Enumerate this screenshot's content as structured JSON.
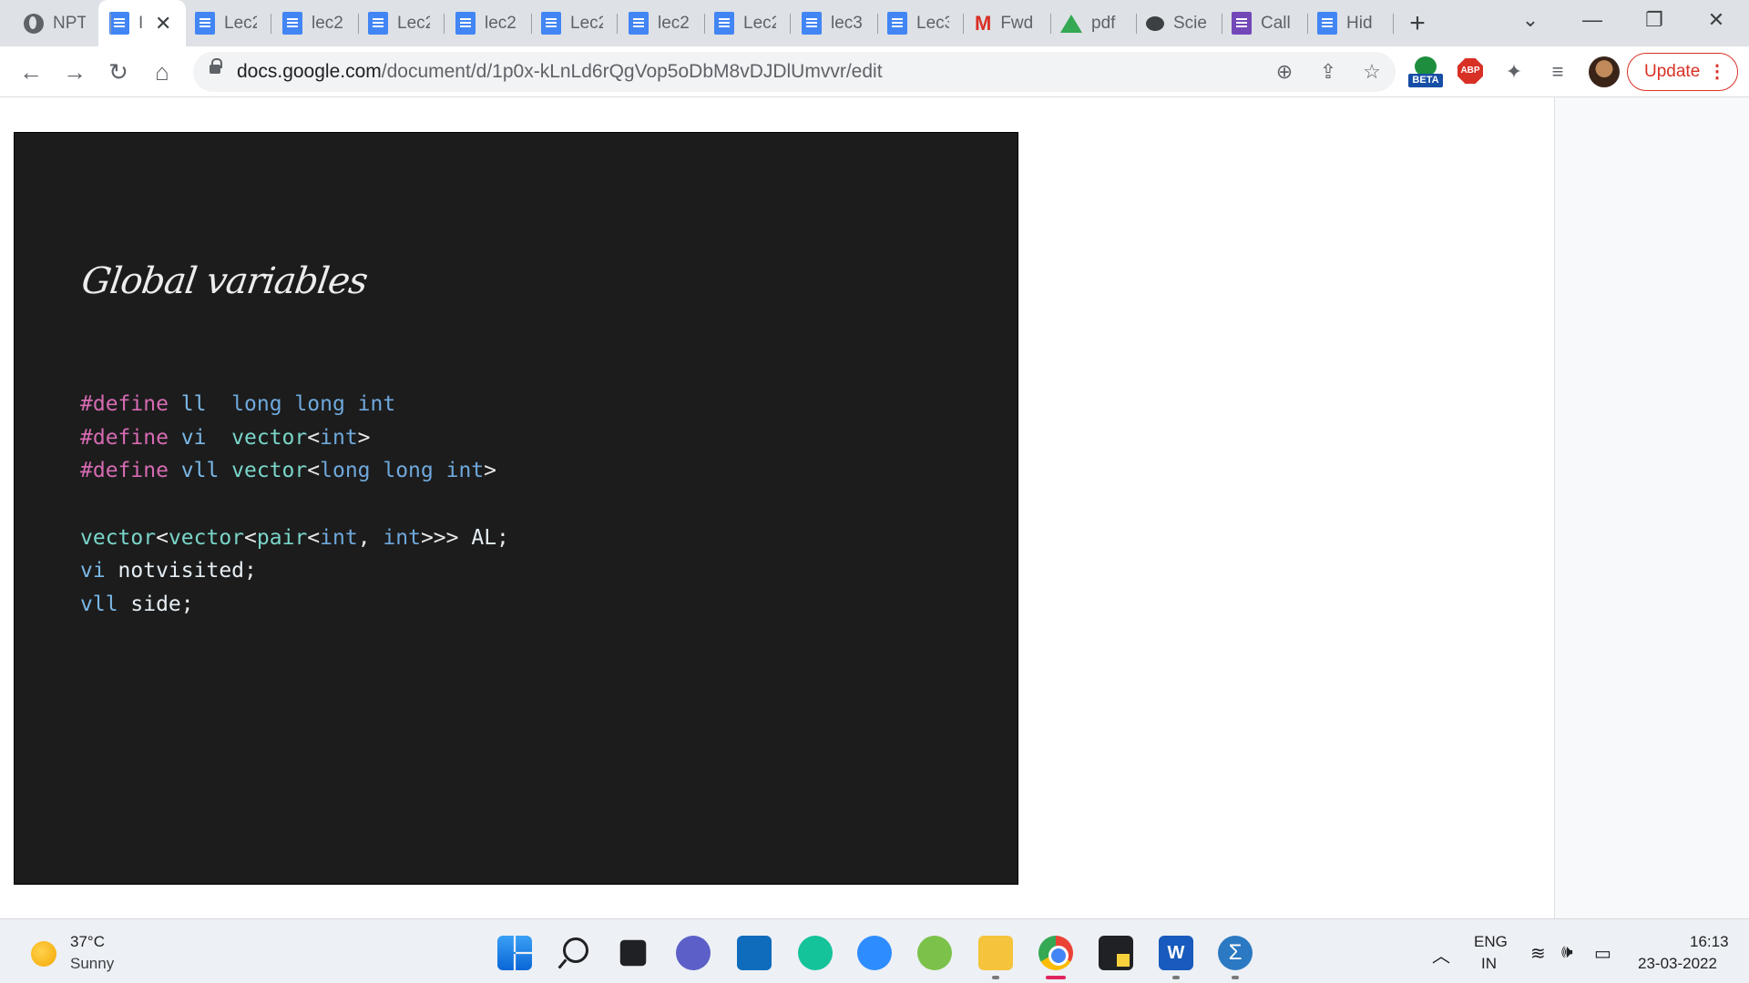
{
  "browser": {
    "tabs": [
      {
        "label": "NPT",
        "icon": "globe-icon"
      },
      {
        "label": "I",
        "icon": "docs-icon",
        "active": true
      },
      {
        "label": "Lec2",
        "icon": "docs-icon"
      },
      {
        "label": "lec2",
        "icon": "docs-icon"
      },
      {
        "label": "Lec2",
        "icon": "docs-icon"
      },
      {
        "label": "lec2",
        "icon": "docs-icon"
      },
      {
        "label": "Lec2",
        "icon": "docs-icon"
      },
      {
        "label": "lec2",
        "icon": "docs-icon"
      },
      {
        "label": "Lec2",
        "icon": "docs-icon"
      },
      {
        "label": "lec3",
        "icon": "docs-icon"
      },
      {
        "label": "Lec3",
        "icon": "docs-icon"
      },
      {
        "label": "Fwd",
        "icon": "gmail-icon"
      },
      {
        "label": "pdf",
        "icon": "drive-icon"
      },
      {
        "label": "Scie",
        "icon": "chat-icon"
      },
      {
        "label": "Call",
        "icon": "forms-icon"
      },
      {
        "label": "Hid",
        "icon": "docs-icon"
      }
    ],
    "new_tab": "+",
    "url_host": "docs.google.com",
    "url_path": "/document/d/1p0x-kLnLd6rQgVop5oDbM8vDJDlUmvvr/edit",
    "extensions": {
      "beta_label": "BETA",
      "abp_label": "ABP"
    },
    "update_label": "Update"
  },
  "document": {
    "slide_title": "Global variables",
    "code_lines": [
      [
        [
          "#define ",
          "c-dir"
        ],
        [
          "ll  ",
          "c-mac"
        ],
        [
          "long long int",
          "c-kw"
        ]
      ],
      [
        [
          "#define ",
          "c-dir"
        ],
        [
          "vi  ",
          "c-mac"
        ],
        [
          "vector",
          "c-typ"
        ],
        [
          "<",
          "c-pun"
        ],
        [
          "int",
          "c-kw"
        ],
        [
          ">",
          "c-pun"
        ]
      ],
      [
        [
          "#define ",
          "c-dir"
        ],
        [
          "vll ",
          "c-mac"
        ],
        [
          "vector",
          "c-typ"
        ],
        [
          "<",
          "c-pun"
        ],
        [
          "long long int",
          "c-kw"
        ],
        [
          ">",
          "c-pun"
        ]
      ],
      [
        [
          "",
          "c-pun"
        ]
      ],
      [
        [
          "vector",
          "c-typ"
        ],
        [
          "<",
          "c-pun"
        ],
        [
          "vector",
          "c-typ"
        ],
        [
          "<",
          "c-pun"
        ],
        [
          "pair",
          "c-typ"
        ],
        [
          "<",
          "c-pun"
        ],
        [
          "int",
          "c-kw"
        ],
        [
          ", ",
          "c-pun"
        ],
        [
          "int",
          "c-kw"
        ],
        [
          ">>> ",
          "c-pun"
        ],
        [
          "AL",
          "c-id"
        ],
        [
          ";",
          "c-pun"
        ]
      ],
      [
        [
          "vi ",
          "c-mac"
        ],
        [
          "notvisited",
          "c-id"
        ],
        [
          ";",
          "c-pun"
        ]
      ],
      [
        [
          "vll ",
          "c-mac"
        ],
        [
          "side",
          "c-id"
        ],
        [
          ";",
          "c-pun"
        ]
      ]
    ]
  },
  "taskbar": {
    "weather_temp": "37°C",
    "weather_desc": "Sunny",
    "lang_top": "ENG",
    "lang_bottom": "IN",
    "time": "16:13",
    "date": "23-03-2022",
    "word_letter": "W",
    "sigma_symbol": "Σ"
  }
}
